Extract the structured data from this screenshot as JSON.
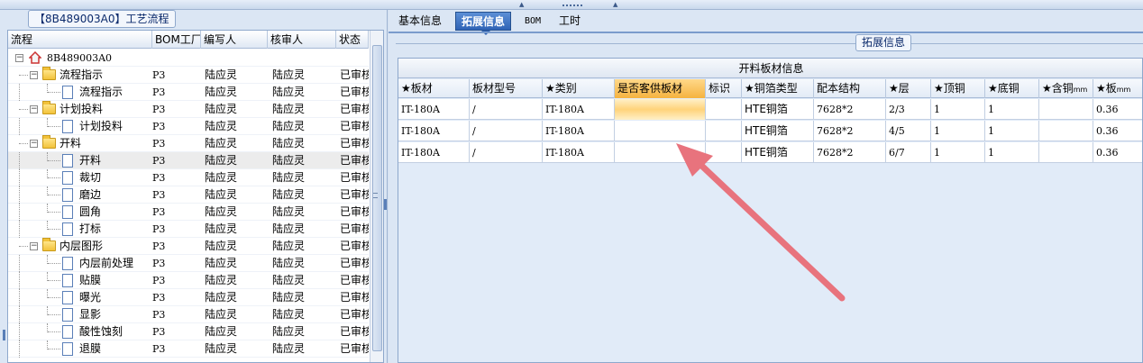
{
  "left_panel": {
    "title": "【8B489003A0】工艺流程",
    "headers": [
      "流程",
      "BOM工厂",
      "编写人",
      "核审人",
      "状态"
    ],
    "root_label": "8B489003A0",
    "rows": [
      {
        "level": 1,
        "kind": "folder",
        "name": "流程指示",
        "bom": "P3",
        "writer": "陆应灵",
        "reviewer": "陆应灵",
        "status": "已审核"
      },
      {
        "level": 2,
        "kind": "doc",
        "name": "流程指示",
        "bom": "P3",
        "writer": "陆应灵",
        "reviewer": "陆应灵",
        "status": "已审核"
      },
      {
        "level": 1,
        "kind": "folder",
        "name": "计划投料",
        "bom": "P3",
        "writer": "陆应灵",
        "reviewer": "陆应灵",
        "status": "已审核"
      },
      {
        "level": 2,
        "kind": "doc",
        "name": "计划投料",
        "bom": "P3",
        "writer": "陆应灵",
        "reviewer": "陆应灵",
        "status": "已审核"
      },
      {
        "level": 1,
        "kind": "folder",
        "name": "开料",
        "bom": "P3",
        "writer": "陆应灵",
        "reviewer": "陆应灵",
        "status": "已审核"
      },
      {
        "level": 2,
        "kind": "doc",
        "name": "开料",
        "bom": "P3",
        "writer": "陆应灵",
        "reviewer": "陆应灵",
        "status": "已审核",
        "selected": true
      },
      {
        "level": 2,
        "kind": "doc",
        "name": "裁切",
        "bom": "P3",
        "writer": "陆应灵",
        "reviewer": "陆应灵",
        "status": "已审核"
      },
      {
        "level": 2,
        "kind": "doc",
        "name": "磨边",
        "bom": "P3",
        "writer": "陆应灵",
        "reviewer": "陆应灵",
        "status": "已审核"
      },
      {
        "level": 2,
        "kind": "doc",
        "name": "圆角",
        "bom": "P3",
        "writer": "陆应灵",
        "reviewer": "陆应灵",
        "status": "已审核"
      },
      {
        "level": 2,
        "kind": "doc",
        "name": "打标",
        "bom": "P3",
        "writer": "陆应灵",
        "reviewer": "陆应灵",
        "status": "已审核"
      },
      {
        "level": 1,
        "kind": "folder",
        "name": "内层图形",
        "bom": "P3",
        "writer": "陆应灵",
        "reviewer": "陆应灵",
        "status": "已审核"
      },
      {
        "level": 2,
        "kind": "doc",
        "name": "内层前处理",
        "bom": "P3",
        "writer": "陆应灵",
        "reviewer": "陆应灵",
        "status": "已审核"
      },
      {
        "level": 2,
        "kind": "doc",
        "name": "贴膜",
        "bom": "P3",
        "writer": "陆应灵",
        "reviewer": "陆应灵",
        "status": "已审核"
      },
      {
        "level": 2,
        "kind": "doc",
        "name": "曝光",
        "bom": "P3",
        "writer": "陆应灵",
        "reviewer": "陆应灵",
        "status": "已审核"
      },
      {
        "level": 2,
        "kind": "doc",
        "name": "显影",
        "bom": "P3",
        "writer": "陆应灵",
        "reviewer": "陆应灵",
        "status": "已审核"
      },
      {
        "level": 2,
        "kind": "doc",
        "name": "酸性蚀刻",
        "bom": "P3",
        "writer": "陆应灵",
        "reviewer": "陆应灵",
        "status": "已审核"
      },
      {
        "level": 2,
        "kind": "doc",
        "name": "退膜",
        "bom": "P3",
        "writer": "陆应灵",
        "reviewer": "陆应灵",
        "status": "已审核"
      }
    ]
  },
  "tabs": [
    {
      "label": "基本信息",
      "active": false
    },
    {
      "label": "拓展信息",
      "active": true
    },
    {
      "label": "BOM",
      "active": false
    },
    {
      "label": "工时",
      "active": false
    }
  ],
  "ext_group_label": "拓展信息",
  "grid": {
    "title": "开料板材信息",
    "headers": [
      "★板材",
      "板材型号",
      "★类别",
      "是否客供板材",
      "标识",
      "★铜箔类型",
      "配本结构",
      "★层",
      "★顶铜",
      "★底铜",
      "★含铜",
      "★板"
    ],
    "header_units": [
      "",
      "",
      "",
      "",
      "",
      "",
      "",
      "",
      "",
      "",
      "mm",
      "mm"
    ],
    "highlight_header_index": 3,
    "rows": [
      [
        "IT-180A",
        "/",
        "IT-180A",
        "",
        "",
        "HTE铜箔",
        "7628*2",
        "2/3",
        "1",
        "1",
        "",
        "0.36"
      ],
      [
        "IT-180A",
        "/",
        "IT-180A",
        "",
        "",
        "HTE铜箔",
        "7628*2",
        "4/5",
        "1",
        "1",
        "",
        "0.36"
      ],
      [
        "IT-180A",
        "/",
        "IT-180A",
        "",
        "",
        "HTE铜箔",
        "7628*2",
        "6/7",
        "1",
        "1",
        "",
        "0.36"
      ]
    ],
    "active_cell": [
      0,
      3
    ]
  },
  "annotation_arrow_color": "#e8737d"
}
